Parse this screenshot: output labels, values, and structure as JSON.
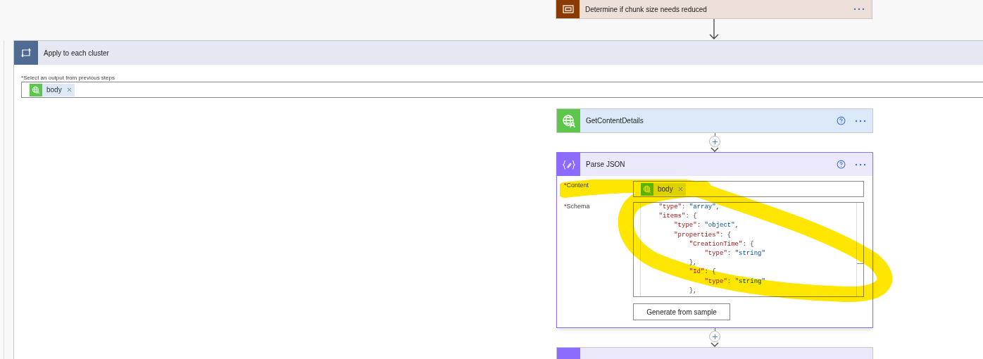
{
  "top_step": {
    "title": "Determine if chunk size needs reduced"
  },
  "loop": {
    "title": "Apply to each cluster",
    "output_label": "Select an output from previous steps",
    "required_mark": "*",
    "token": "body"
  },
  "get_content_details": {
    "title": "GetContentDetails"
  },
  "parse_json": {
    "title": "Parse JSON",
    "content_label": "Content",
    "content_required_mark": "*",
    "content_token": "body",
    "schema_label": "Schema",
    "schema_required_mark": "*",
    "schema_lines": [
      "    \"type\": \"array\",",
      "    \"items\": {",
      "        \"type\": \"object\",",
      "        \"properties\": {",
      "            \"CreationTime\": {",
      "                \"type\": \"string\"",
      "            },",
      "            \"Id\": {",
      "                \"type\": \"string\"",
      "            },"
    ],
    "button": "Generate from sample"
  }
}
